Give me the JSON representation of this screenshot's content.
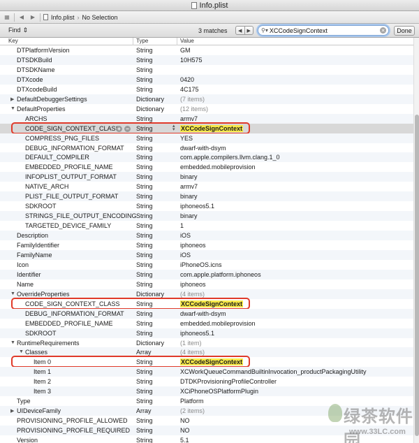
{
  "window": {
    "title": "Info.plist"
  },
  "jumpbar": {
    "file": "Info.plist",
    "selection": "No Selection"
  },
  "findbar": {
    "mode": "Find",
    "matches": "3 matches",
    "query": "XCCodeSignContext",
    "done": "Done"
  },
  "columns": {
    "key": "Key",
    "type": "Type",
    "value": "Value"
  },
  "rows": [
    {
      "key": "DTPlatformVersion",
      "type": "String",
      "value": "GM",
      "indent": 0
    },
    {
      "key": "DTSDKBuild",
      "type": "String",
      "value": "10H575",
      "indent": 0
    },
    {
      "key": "DTSDKName",
      "type": "String",
      "value": "",
      "indent": 0
    },
    {
      "key": "DTXcode",
      "type": "String",
      "value": "0420",
      "indent": 0
    },
    {
      "key": "DTXcodeBuild",
      "type": "String",
      "value": "4C175",
      "indent": 0
    },
    {
      "key": "DefaultDebuggerSettings",
      "type": "Dictionary",
      "value": "(7 items)",
      "indent": 0,
      "disclosure": "closed",
      "muted": true
    },
    {
      "key": "DefaultProperties",
      "type": "Dictionary",
      "value": "(12 items)",
      "indent": 0,
      "disclosure": "open",
      "muted": true
    },
    {
      "key": "ARCHS",
      "type": "String",
      "value": "armv7",
      "indent": 1
    },
    {
      "key": "CODE_SIGN_CONTEXT_CLASS",
      "type": "String",
      "value": "XCCodeSignContext",
      "indent": 1,
      "match": true,
      "selected": true
    },
    {
      "key": "COMPRESS_PNG_FILES",
      "type": "String",
      "value": "YES",
      "indent": 1
    },
    {
      "key": "DEBUG_INFORMATION_FORMAT",
      "type": "String",
      "value": "dwarf-with-dsym",
      "indent": 1
    },
    {
      "key": "DEFAULT_COMPILER",
      "type": "String",
      "value": "com.apple.compilers.llvm.clang.1_0",
      "indent": 1
    },
    {
      "key": "EMBEDDED_PROFILE_NAME",
      "type": "String",
      "value": "embedded.mobileprovision",
      "indent": 1
    },
    {
      "key": "INFOPLIST_OUTPUT_FORMAT",
      "type": "String",
      "value": "binary",
      "indent": 1
    },
    {
      "key": "NATIVE_ARCH",
      "type": "String",
      "value": "armv7",
      "indent": 1
    },
    {
      "key": "PLIST_FILE_OUTPUT_FORMAT",
      "type": "String",
      "value": "binary",
      "indent": 1
    },
    {
      "key": "SDKROOT",
      "type": "String",
      "value": "iphoneos5.1",
      "indent": 1
    },
    {
      "key": "STRINGS_FILE_OUTPUT_ENCODING",
      "type": "String",
      "value": "binary",
      "indent": 1
    },
    {
      "key": "TARGETED_DEVICE_FAMILY",
      "type": "String",
      "value": "1",
      "indent": 1
    },
    {
      "key": "Description",
      "type": "String",
      "value": "iOS",
      "indent": 0
    },
    {
      "key": "FamilyIdentifier",
      "type": "String",
      "value": "iphoneos",
      "indent": 0
    },
    {
      "key": "FamilyName",
      "type": "String",
      "value": "iOS",
      "indent": 0
    },
    {
      "key": "Icon",
      "type": "String",
      "value": "iPhoneOS.icns",
      "indent": 0
    },
    {
      "key": "Identifier",
      "type": "String",
      "value": "com.apple.platform.iphoneos",
      "indent": 0
    },
    {
      "key": "Name",
      "type": "String",
      "value": "iphoneos",
      "indent": 0
    },
    {
      "key": "OverrideProperties",
      "type": "Dictionary",
      "value": "(4 items)",
      "indent": 0,
      "disclosure": "open",
      "muted": true
    },
    {
      "key": "CODE_SIGN_CONTEXT_CLASS",
      "type": "String",
      "value": "XCCodeSignContext",
      "indent": 1,
      "match": true
    },
    {
      "key": "DEBUG_INFORMATION_FORMAT",
      "type": "String",
      "value": "dwarf-with-dsym",
      "indent": 1
    },
    {
      "key": "EMBEDDED_PROFILE_NAME",
      "type": "String",
      "value": "embedded.mobileprovision",
      "indent": 1
    },
    {
      "key": "SDKROOT",
      "type": "String",
      "value": "iphoneos5.1",
      "indent": 1
    },
    {
      "key": "RuntimeRequirements",
      "type": "Dictionary",
      "value": "(1 item)",
      "indent": 0,
      "disclosure": "open",
      "muted": true
    },
    {
      "key": "Classes",
      "type": "Array",
      "value": "(4 items)",
      "indent": 1,
      "disclosure": "open",
      "muted": true
    },
    {
      "key": "Item 0",
      "type": "String",
      "value": "XCCodeSignContext",
      "indent": 2,
      "match": true
    },
    {
      "key": "Item 1",
      "type": "String",
      "value": "XCWorkQueueCommandBuiltinInvocation_productPackagingUtility",
      "indent": 2
    },
    {
      "key": "Item 2",
      "type": "String",
      "value": "DTDKProvisioningProfileController",
      "indent": 2
    },
    {
      "key": "Item 3",
      "type": "String",
      "value": "XCiPhoneOSPlatformPlugin",
      "indent": 2
    },
    {
      "key": "Type",
      "type": "String",
      "value": "Platform",
      "indent": 0
    },
    {
      "key": "UIDeviceFamily",
      "type": "Array",
      "value": "(2 items)",
      "indent": 0,
      "disclosure": "closed",
      "muted": true
    },
    {
      "key": "PROVISIONING_PROFILE_ALLOWED",
      "type": "String",
      "value": "NO",
      "indent": 0
    },
    {
      "key": "PROVISIONING_PROFILE_REQUIRED",
      "type": "String",
      "value": "NO",
      "indent": 0
    },
    {
      "key": "Version",
      "type": "String",
      "value": "5.1",
      "indent": 0
    }
  ],
  "watermark": {
    "text": "绿茶软件园",
    "url": "www.33LC.com"
  },
  "colors": {
    "highlight": "#e03a2a",
    "match_fill": "#f7e84a",
    "selected_row": "#d8d8d8"
  }
}
